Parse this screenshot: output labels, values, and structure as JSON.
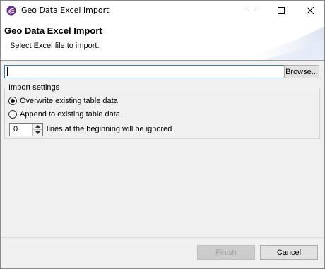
{
  "window": {
    "title": "Geo Data Excel Import",
    "icon": "app-logo-icon"
  },
  "banner": {
    "title": "Geo Data Excel Import",
    "description": "Select Excel file to import."
  },
  "file": {
    "value": "",
    "browse_label": "Browse..."
  },
  "import_settings": {
    "legend": "Import settings",
    "options": [
      {
        "label": "Overwrite existing table data",
        "checked": true
      },
      {
        "label": "Append to existing table data",
        "checked": false
      }
    ],
    "skip_lines": {
      "value": "0",
      "label": "lines at the beginning will be ignored"
    }
  },
  "footer": {
    "finish_label": "Finish",
    "finish_enabled": false,
    "cancel_label": "Cancel"
  },
  "colors": {
    "focus_border": "#3c7fb1",
    "logo_purple": "#6b2d8f"
  }
}
